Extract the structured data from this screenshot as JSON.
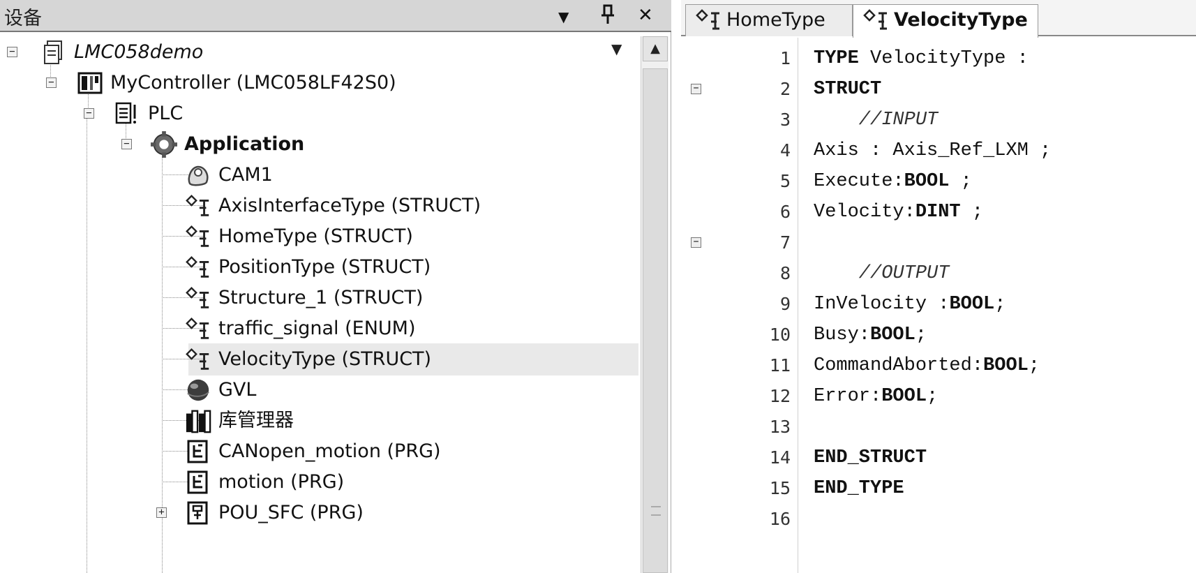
{
  "devices_panel": {
    "title": "设备",
    "buttons": {
      "dropdown": "▼",
      "pin": "ㅍ",
      "close": "✕"
    }
  },
  "tree": [
    {
      "label": "LMC058demo",
      "icon": "project-icon",
      "style": "italic"
    },
    {
      "label": "MyController (LMC058LF42S0)",
      "icon": "controller-icon"
    },
    {
      "label": "PLC",
      "icon": "plc-icon"
    },
    {
      "label": "Application",
      "icon": "application-gear-icon",
      "style": "bold"
    },
    {
      "label": "CAM1",
      "icon": "cam-icon"
    },
    {
      "label": "AxisInterfaceType (STRUCT)",
      "icon": "dut-icon"
    },
    {
      "label": "HomeType (STRUCT)",
      "icon": "dut-icon"
    },
    {
      "label": "PositionType (STRUCT)",
      "icon": "dut-icon"
    },
    {
      "label": "Structure_1 (STRUCT)",
      "icon": "dut-icon"
    },
    {
      "label": "traffic_signal (ENUM)",
      "icon": "dut-icon"
    },
    {
      "label": "VelocityType (STRUCT)",
      "icon": "dut-icon",
      "selected": true
    },
    {
      "label": "GVL",
      "icon": "gvl-globe-icon"
    },
    {
      "label": "库管理器",
      "icon": "library-manager-icon"
    },
    {
      "label": "CANopen_motion (PRG)",
      "icon": "pou-icon"
    },
    {
      "label": "motion (PRG)",
      "icon": "pou-icon"
    },
    {
      "label": "POU_SFC (PRG)",
      "icon": "sfc-pou-icon"
    }
  ],
  "editor": {
    "tabs": [
      {
        "label": "HomeType",
        "active": false
      },
      {
        "label": "VelocityType",
        "active": true
      }
    ],
    "lines": [
      {
        "num": "1",
        "parts": [
          [
            "TYPE",
            "kw"
          ],
          [
            " VelocityType :",
            ""
          ]
        ]
      },
      {
        "num": "2",
        "parts": [
          [
            "STRUCT",
            "kw"
          ]
        ],
        "fold": "−"
      },
      {
        "num": "3",
        "parts": [
          [
            "    //INPUT",
            "cm"
          ]
        ]
      },
      {
        "num": "4",
        "parts": [
          [
            "Axis : Axis_Ref_LXM ;",
            ""
          ]
        ]
      },
      {
        "num": "5",
        "parts": [
          [
            "Execute:",
            ""
          ],
          [
            "BOOL",
            "kw"
          ],
          [
            " ;",
            ""
          ]
        ]
      },
      {
        "num": "6",
        "parts": [
          [
            "Velocity:",
            ""
          ],
          [
            "DINT",
            "kw"
          ],
          [
            " ;",
            ""
          ]
        ]
      },
      {
        "num": "7",
        "parts": [],
        "fold": "−"
      },
      {
        "num": "8",
        "parts": [
          [
            "    //OUTPUT",
            "cm"
          ]
        ]
      },
      {
        "num": "9",
        "parts": [
          [
            "InVelocity :",
            ""
          ],
          [
            "BOOL",
            "kw"
          ],
          [
            ";",
            ""
          ]
        ]
      },
      {
        "num": "10",
        "parts": [
          [
            "Busy:",
            ""
          ],
          [
            "BOOL",
            "kw"
          ],
          [
            ";",
            ""
          ]
        ]
      },
      {
        "num": "11",
        "parts": [
          [
            "CommandAborted:",
            ""
          ],
          [
            "BOOL",
            "kw"
          ],
          [
            ";",
            ""
          ]
        ]
      },
      {
        "num": "12",
        "parts": [
          [
            "Error:",
            ""
          ],
          [
            "BOOL",
            "kw"
          ],
          [
            ";",
            ""
          ]
        ]
      },
      {
        "num": "13",
        "parts": []
      },
      {
        "num": "14",
        "parts": [
          [
            "END_STRUCT",
            "kw"
          ]
        ]
      },
      {
        "num": "15",
        "parts": [
          [
            "END_TYPE",
            "kw"
          ]
        ]
      },
      {
        "num": "16",
        "parts": []
      }
    ]
  }
}
